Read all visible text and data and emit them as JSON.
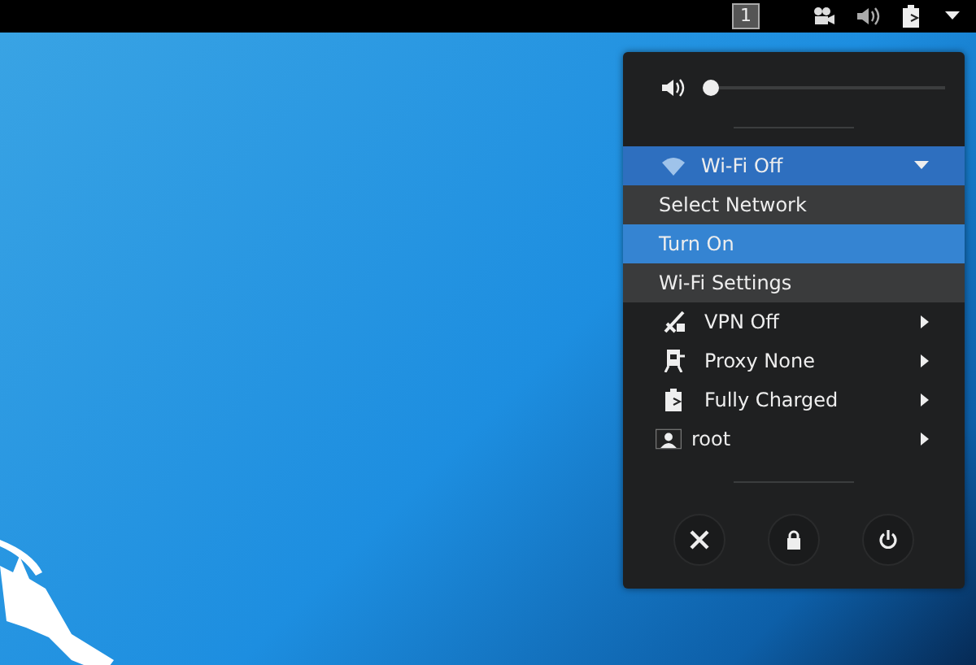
{
  "top_bar": {
    "workspace": "1"
  },
  "volume": {
    "level": 0.0
  },
  "wifi": {
    "label": "Wi-Fi Off",
    "expanded": true,
    "submenu": [
      {
        "label": "Select Network",
        "selected": false
      },
      {
        "label": "Turn On",
        "selected": true
      },
      {
        "label": "Wi-Fi Settings",
        "selected": false
      }
    ]
  },
  "status_items": [
    {
      "kind": "vpn",
      "label": "VPN Off"
    },
    {
      "kind": "proxy",
      "label": "Proxy None"
    },
    {
      "kind": "battery",
      "label": "Fully Charged"
    },
    {
      "kind": "user",
      "label": "root"
    }
  ]
}
